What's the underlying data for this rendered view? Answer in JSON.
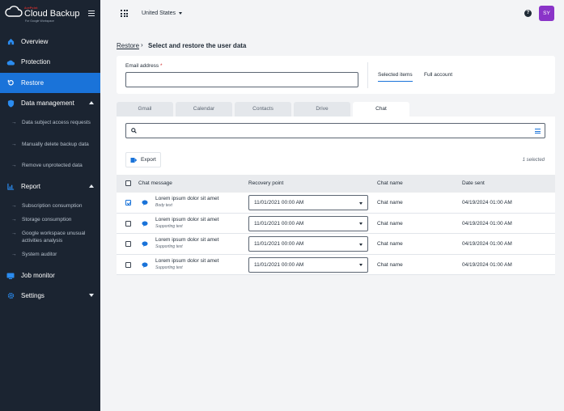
{
  "brand": {
    "small": "AvePoint",
    "name": "Cloud Backup",
    "sub": "For Google Workspace"
  },
  "sidebar": {
    "items": [
      {
        "label": "Overview",
        "icon": "home-icon"
      },
      {
        "label": "Protection",
        "icon": "cloud-icon"
      },
      {
        "label": "Restore",
        "icon": "restore-icon",
        "active": true
      },
      {
        "label": "Data management",
        "icon": "shield-icon",
        "expanded": true
      },
      {
        "label": "Report",
        "icon": "report-icon",
        "expanded": true
      },
      {
        "label": "Job monitor",
        "icon": "monitor-icon"
      },
      {
        "label": "Settings",
        "icon": "gear-icon",
        "expanded": false
      }
    ],
    "data_management_sub": [
      "Data subject access requests",
      "Manually delete backup data",
      "Remove unprotected data"
    ],
    "report_sub": [
      "Subscription consumption",
      "Storage consumption",
      "Google workspace unusual activities analysis",
      "System auditor"
    ]
  },
  "topbar": {
    "country": "United States",
    "help": "?",
    "avatar": "SY"
  },
  "breadcrumb": {
    "link": "Restore",
    "separator": "›",
    "title": "Select and restore the user data"
  },
  "email": {
    "label": "Email address",
    "required": "*",
    "value": "",
    "placeholder": ""
  },
  "modes": [
    "Selected items",
    "Full account"
  ],
  "tabs": [
    "Gmail",
    "Calendar",
    "Contacts",
    "Drive",
    "Chat"
  ],
  "search": {
    "value": "",
    "placeholder": ""
  },
  "toolbar": {
    "export_label": "Export",
    "selected_count": "1 selected"
  },
  "table": {
    "headers": [
      "Chat message",
      "Recovery point",
      "Chat name",
      "Date sent"
    ],
    "rows": [
      {
        "checked": true,
        "message": "Lorem ipsum dolor sit amet",
        "sub": "Body text",
        "recovery": "11/01/2021 00:00 AM",
        "chat_name": "Chat name",
        "date": "04/19/2024 01:00 AM"
      },
      {
        "checked": false,
        "message": "Lorem ipsum dolor sit amet",
        "sub": "Supporting text",
        "recovery": "11/01/2021 00:00 AM",
        "chat_name": "Chat name",
        "date": "04/19/2024 01:00 AM"
      },
      {
        "checked": false,
        "message": "Lorem ipsum dolor sit amet",
        "sub": "Supporting text",
        "recovery": "11/01/2021 00:00 AM",
        "chat_name": "Chat name",
        "date": "04/19/2024 01:00 AM"
      },
      {
        "checked": false,
        "message": "Lorem ipsum dolor sit amet",
        "sub": "Supporting text",
        "recovery": "11/01/2021 00:00 AM",
        "chat_name": "Chat name",
        "date": "04/19/2024 01:00 AM"
      }
    ]
  },
  "colors": {
    "sidebar_bg": "#1b2431",
    "accent": "#1a73d9",
    "avatar_bg": "#8a34c8",
    "required": "#d02e2e"
  }
}
